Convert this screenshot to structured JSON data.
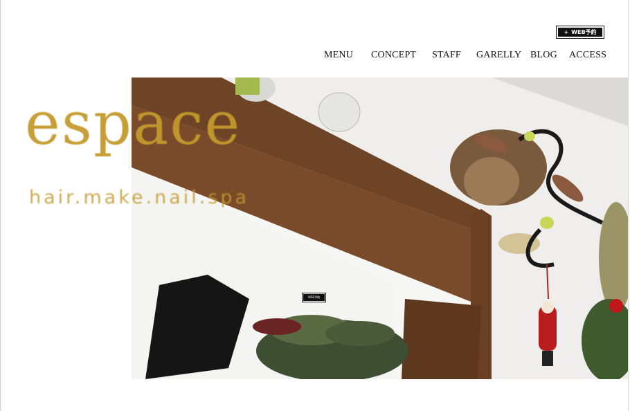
{
  "header": {
    "web_booking_label": "WEB予約",
    "web_booking_icon": "plus-icon"
  },
  "nav": {
    "items": [
      {
        "label": "MENU"
      },
      {
        "label": "CONCEPT"
      },
      {
        "label": "STAFF"
      },
      {
        "label": "GARELLY"
      },
      {
        "label": "BLOG"
      },
      {
        "label": "ACCESS"
      }
    ]
  },
  "logo": {
    "word": "espace",
    "subtitle": "hair.make.nail.spa",
    "color": "#c49a2c"
  },
  "hero": {
    "overlay_button_label": "WEB予約"
  }
}
